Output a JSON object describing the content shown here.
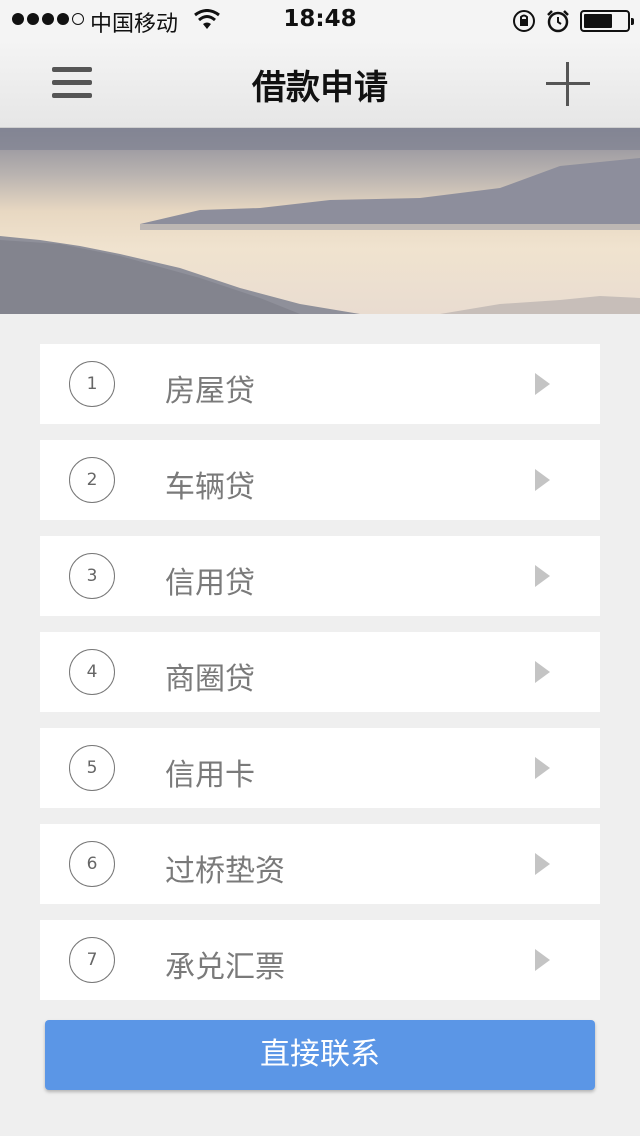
{
  "status_bar": {
    "carrier": "中国移动",
    "time": "18:48"
  },
  "nav": {
    "title": "借款申请"
  },
  "loan_types": [
    {
      "number": "1",
      "label": "房屋贷"
    },
    {
      "number": "2",
      "label": "车辆贷"
    },
    {
      "number": "3",
      "label": "信用贷"
    },
    {
      "number": "4",
      "label": "商圈贷"
    },
    {
      "number": "5",
      "label": "信用卡"
    },
    {
      "number": "6",
      "label": "过桥垫资"
    },
    {
      "number": "7",
      "label": "承兑汇票"
    }
  ],
  "contact_button": {
    "label": "直接联系"
  },
  "colors": {
    "accent": "#5b96e6",
    "background": "#efefef",
    "item_text": "#7a7a7a"
  }
}
